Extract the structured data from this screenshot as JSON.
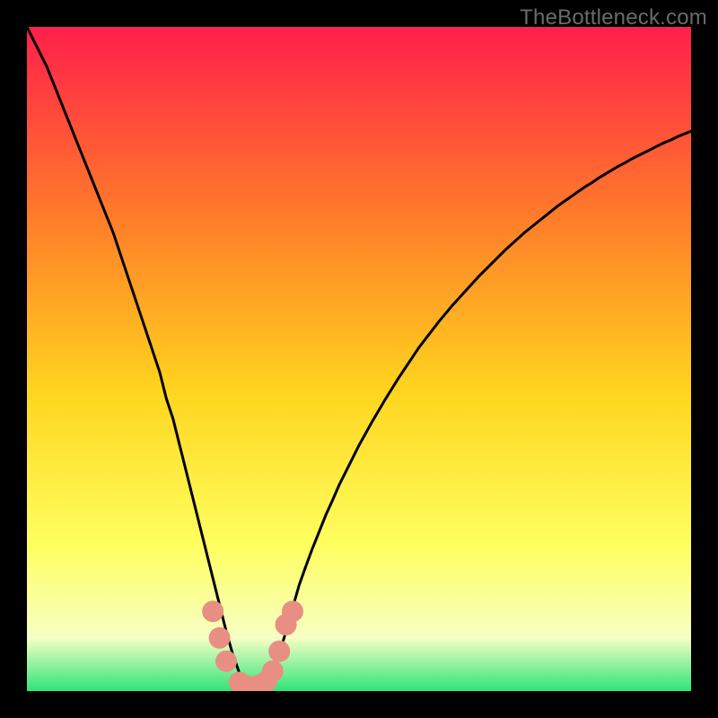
{
  "watermark": "TheBottleneck.com",
  "colors": {
    "frame": "#000000",
    "gradient_top": "#ff1f4b",
    "gradient_mid1": "#ff7a2a",
    "gradient_mid2": "#ffd51e",
    "gradient_mid3": "#ffff60",
    "gradient_mid4": "#f6ffc4",
    "gradient_bottom": "#2fe47a",
    "curve": "#000000",
    "marker": "#e98e83"
  },
  "chart_data": {
    "type": "line",
    "title": "",
    "xlabel": "",
    "ylabel": "",
    "xlim": [
      0,
      100
    ],
    "ylim": [
      0,
      100
    ],
    "x": [
      0,
      1,
      2,
      3,
      4,
      5,
      6,
      7,
      8,
      9,
      10,
      11,
      12,
      13,
      14,
      15,
      16,
      17,
      18,
      19,
      20,
      21,
      22,
      23,
      24,
      25,
      26,
      27,
      28,
      29,
      30,
      31,
      32,
      33,
      34,
      35,
      36,
      37,
      38,
      39,
      40,
      41,
      42,
      43,
      44,
      45,
      46,
      47,
      48,
      49,
      50,
      51,
      52,
      53,
      54,
      55,
      56,
      57,
      58,
      59,
      60,
      61,
      62,
      63,
      64,
      65,
      66,
      67,
      68,
      69,
      70,
      71,
      72,
      73,
      74,
      75,
      76,
      77,
      78,
      79,
      80,
      81,
      82,
      83,
      84,
      85,
      86,
      87,
      88,
      89,
      90,
      91,
      92,
      93,
      94,
      95,
      96,
      97,
      98,
      99,
      100
    ],
    "y": [
      100,
      98,
      96,
      94,
      91.5,
      89,
      86.5,
      84,
      81.5,
      79,
      76.5,
      74,
      71.5,
      69,
      66,
      63,
      60,
      57,
      54,
      51,
      48,
      44,
      41,
      37,
      33,
      29,
      25,
      21,
      17,
      13,
      9,
      5.5,
      2.7,
      1.2,
      0.5,
      0.6,
      1.2,
      2.7,
      5.5,
      9,
      12.5,
      16,
      18.8,
      21.5,
      24,
      26.5,
      28.7,
      31,
      33,
      35,
      37,
      38.8,
      40.6,
      42.3,
      44,
      45.6,
      47.2,
      48.7,
      50.2,
      51.7,
      53,
      54.3,
      55.6,
      56.8,
      58,
      59.1,
      60.2,
      61.3,
      62.4,
      63.4,
      64.4,
      65.4,
      66.4,
      67.3,
      68.2,
      69.1,
      69.9,
      70.7,
      71.5,
      72.3,
      73.1,
      73.8,
      74.5,
      75.2,
      75.9,
      76.5,
      77.2,
      77.8,
      78.4,
      79,
      79.5,
      80.1,
      80.6,
      81.1,
      81.6,
      82.1,
      82.6,
      83,
      83.5,
      83.9,
      84.3
    ],
    "markers": {
      "x": [
        28,
        29,
        30,
        32,
        33,
        35,
        36,
        37,
        38,
        39,
        40
      ],
      "y": [
        12,
        8,
        4.5,
        1.3,
        0.8,
        0.9,
        1.4,
        3,
        6,
        10,
        12
      ]
    }
  }
}
